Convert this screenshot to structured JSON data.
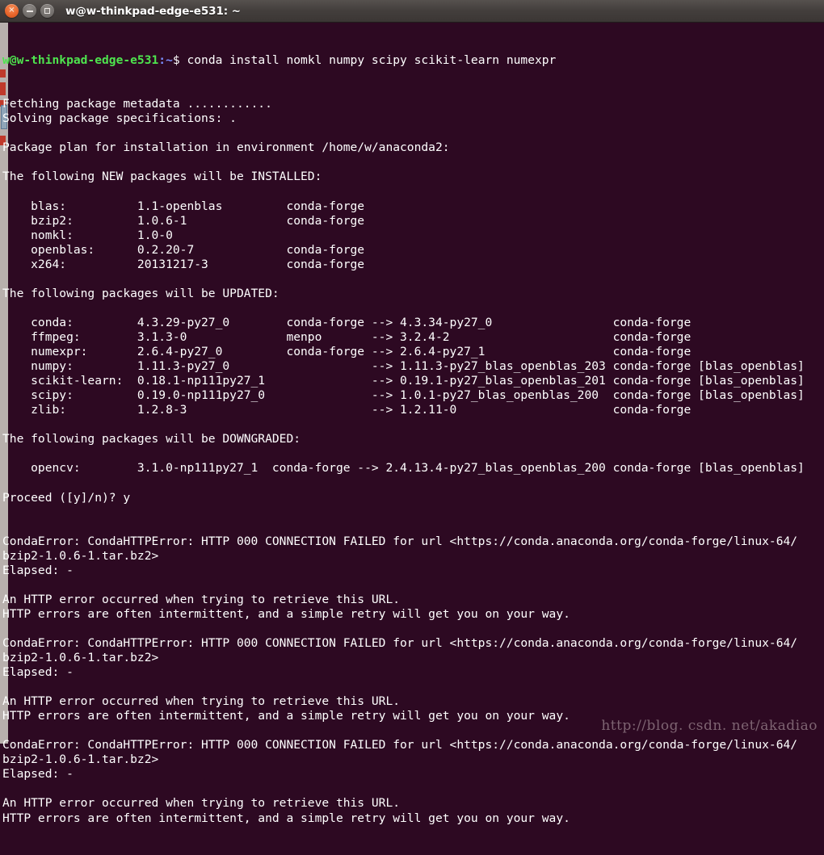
{
  "window": {
    "title": "w@w-thinkpad-edge-e531: ~",
    "controls": {
      "close": "×",
      "minimize": "",
      "maximize": ""
    }
  },
  "terminal": {
    "prompt": {
      "user_host": "w@w-thinkpad-edge-e531",
      "path": ":~",
      "sigil": "$",
      "command": " conda install nomkl numpy scipy scikit-learn numexpr"
    },
    "lines": [
      "Fetching package metadata ............",
      "Solving package specifications: .",
      "",
      "Package plan for installation in environment /home/w/anaconda2:",
      "",
      "The following NEW packages will be INSTALLED:",
      "",
      "    blas:          1.1-openblas         conda-forge",
      "    bzip2:         1.0.6-1              conda-forge",
      "    nomkl:         1.0-0",
      "    openblas:      0.2.20-7             conda-forge",
      "    x264:          20131217-3           conda-forge",
      "",
      "The following packages will be UPDATED:",
      "",
      "    conda:         4.3.29-py27_0        conda-forge --> 4.3.34-py27_0                 conda-forge",
      "    ffmpeg:        3.1.3-0              menpo       --> 3.2.4-2                       conda-forge",
      "    numexpr:       2.6.4-py27_0         conda-forge --> 2.6.4-py27_1                  conda-forge",
      "    numpy:         1.11.3-py27_0                    --> 1.11.3-py27_blas_openblas_203 conda-forge [blas_openblas]",
      "    scikit-learn:  0.18.1-np111py27_1               --> 0.19.1-py27_blas_openblas_201 conda-forge [blas_openblas]",
      "    scipy:         0.19.0-np111py27_0               --> 1.0.1-py27_blas_openblas_200  conda-forge [blas_openblas]",
      "    zlib:          1.2.8-3                          --> 1.2.11-0                      conda-forge",
      "",
      "The following packages will be DOWNGRADED:",
      "",
      "    opencv:        3.1.0-np111py27_1  conda-forge --> 2.4.13.4-py27_blas_openblas_200 conda-forge [blas_openblas]",
      "",
      "Proceed ([y]/n)? y",
      "",
      "",
      "CondaError: CondaHTTPError: HTTP 000 CONNECTION FAILED for url <https://conda.anaconda.org/conda-forge/linux-64/",
      "bzip2-1.0.6-1.tar.bz2>",
      "Elapsed: -",
      "",
      "An HTTP error occurred when trying to retrieve this URL.",
      "HTTP errors are often intermittent, and a simple retry will get you on your way.",
      "",
      "CondaError: CondaHTTPError: HTTP 000 CONNECTION FAILED for url <https://conda.anaconda.org/conda-forge/linux-64/",
      "bzip2-1.0.6-1.tar.bz2>",
      "Elapsed: -",
      "",
      "An HTTP error occurred when trying to retrieve this URL.",
      "HTTP errors are often intermittent, and a simple retry will get you on your way.",
      "",
      "CondaError: CondaHTTPError: HTTP 000 CONNECTION FAILED for url <https://conda.anaconda.org/conda-forge/linux-64/",
      "bzip2-1.0.6-1.tar.bz2>",
      "Elapsed: -",
      "",
      "An HTTP error occurred when trying to retrieve this URL.",
      "HTTP errors are often intermittent, and a simple retry will get you on your way."
    ]
  },
  "watermark": {
    "text": "http://blog. csdn. net/akadiao"
  },
  "colors": {
    "background": "#2d0922",
    "foreground": "#ffffff",
    "prompt_user": "#4ee44e",
    "prompt_path": "#7b8fff",
    "titlebar": "#433e3c",
    "close_button": "#e8642a",
    "watermark": "#7e6472"
  }
}
